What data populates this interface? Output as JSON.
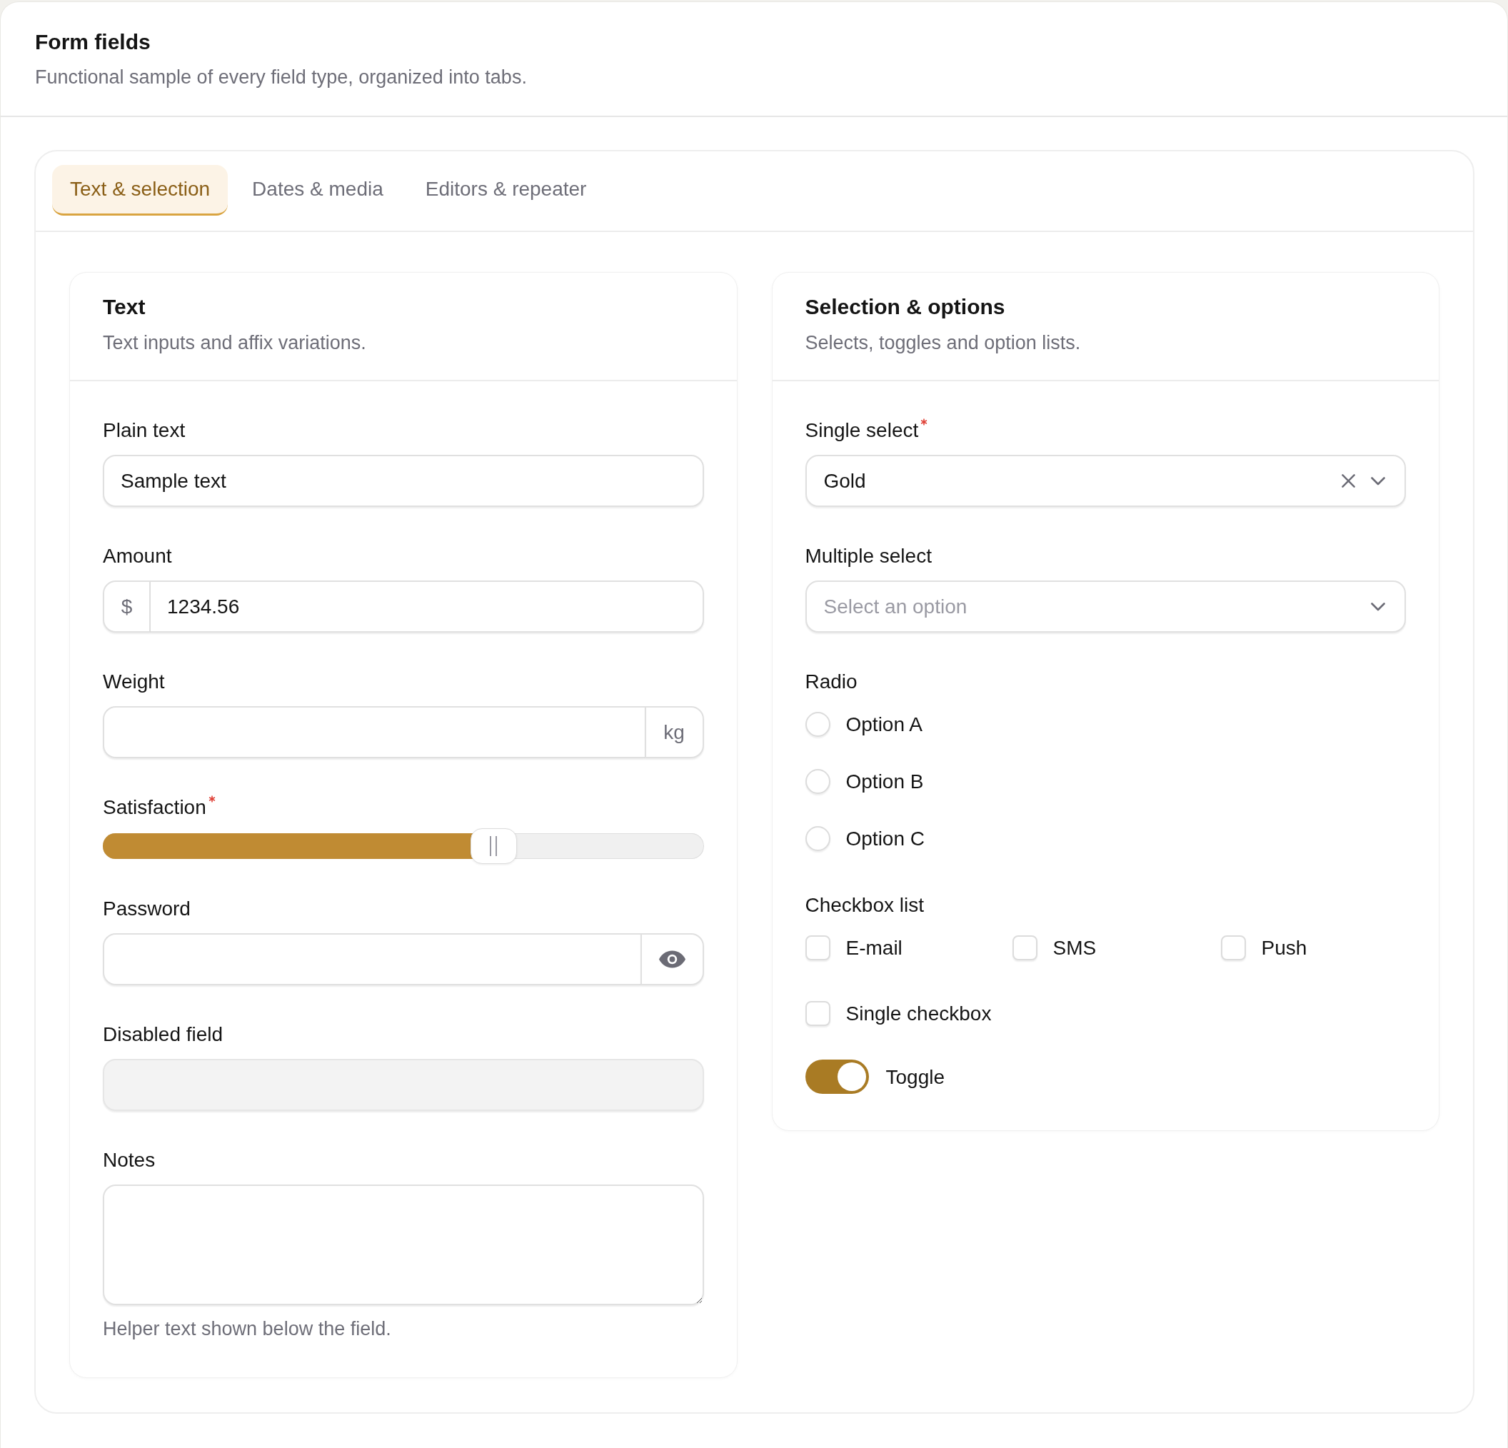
{
  "page": {
    "title": "Form fields",
    "subtitle": "Functional sample of every field type, organized into tabs."
  },
  "tabs": [
    {
      "label": "Text & selection",
      "selected": true
    },
    {
      "label": "Dates & media",
      "selected": false
    },
    {
      "label": "Editors & repeater",
      "selected": false
    }
  ],
  "sections": [
    {
      "title": "Text",
      "subtitle": "Text inputs and affix variations.",
      "fields": [
        {
          "kind": "text",
          "label": "Plain text",
          "required": false,
          "disabled": false,
          "value": "Sample text"
        },
        {
          "kind": "affix",
          "label": "Amount",
          "required": false,
          "prefix": "$",
          "value": "1234.56"
        },
        {
          "kind": "affix",
          "label": "Weight",
          "required": false,
          "suffix": "kg"
        },
        {
          "kind": "slider",
          "label": "Satisfaction",
          "required": true,
          "level": 0.65
        },
        {
          "kind": "password",
          "label": "Password",
          "required": false
        },
        {
          "kind": "text",
          "label": "Disabled field",
          "required": false,
          "disabled": true
        },
        {
          "kind": "textarea",
          "label": "Notes",
          "required": false,
          "helper": "Helper text shown below the field."
        }
      ]
    },
    {
      "title": "Selection & options",
      "subtitle": "Selects, toggles and option lists.",
      "fields": [
        {
          "kind": "select",
          "label": "Single select",
          "required": true,
          "clearable": true,
          "value": "Gold"
        },
        {
          "kind": "select",
          "label": "Multiple select",
          "required": false,
          "clearable": false,
          "placeholder": "Select an option"
        },
        {
          "kind": "radio",
          "label": "Radio",
          "required": false,
          "options": [
            {
              "label": "Option A",
              "selected": false
            },
            {
              "label": "Option B",
              "selected": false
            },
            {
              "label": "Option C",
              "selected": false
            }
          ]
        },
        {
          "kind": "checkbox_list",
          "label": "Checkbox list",
          "required": false,
          "options": [
            {
              "label": "E-mail",
              "checked": false
            },
            {
              "label": "SMS",
              "checked": false
            },
            {
              "label": "Push",
              "checked": false
            }
          ]
        },
        {
          "kind": "checkbox",
          "label": "Single checkbox",
          "checked": false
        },
        {
          "kind": "toggle",
          "label": "Toggle",
          "on": true
        }
      ]
    }
  ]
}
